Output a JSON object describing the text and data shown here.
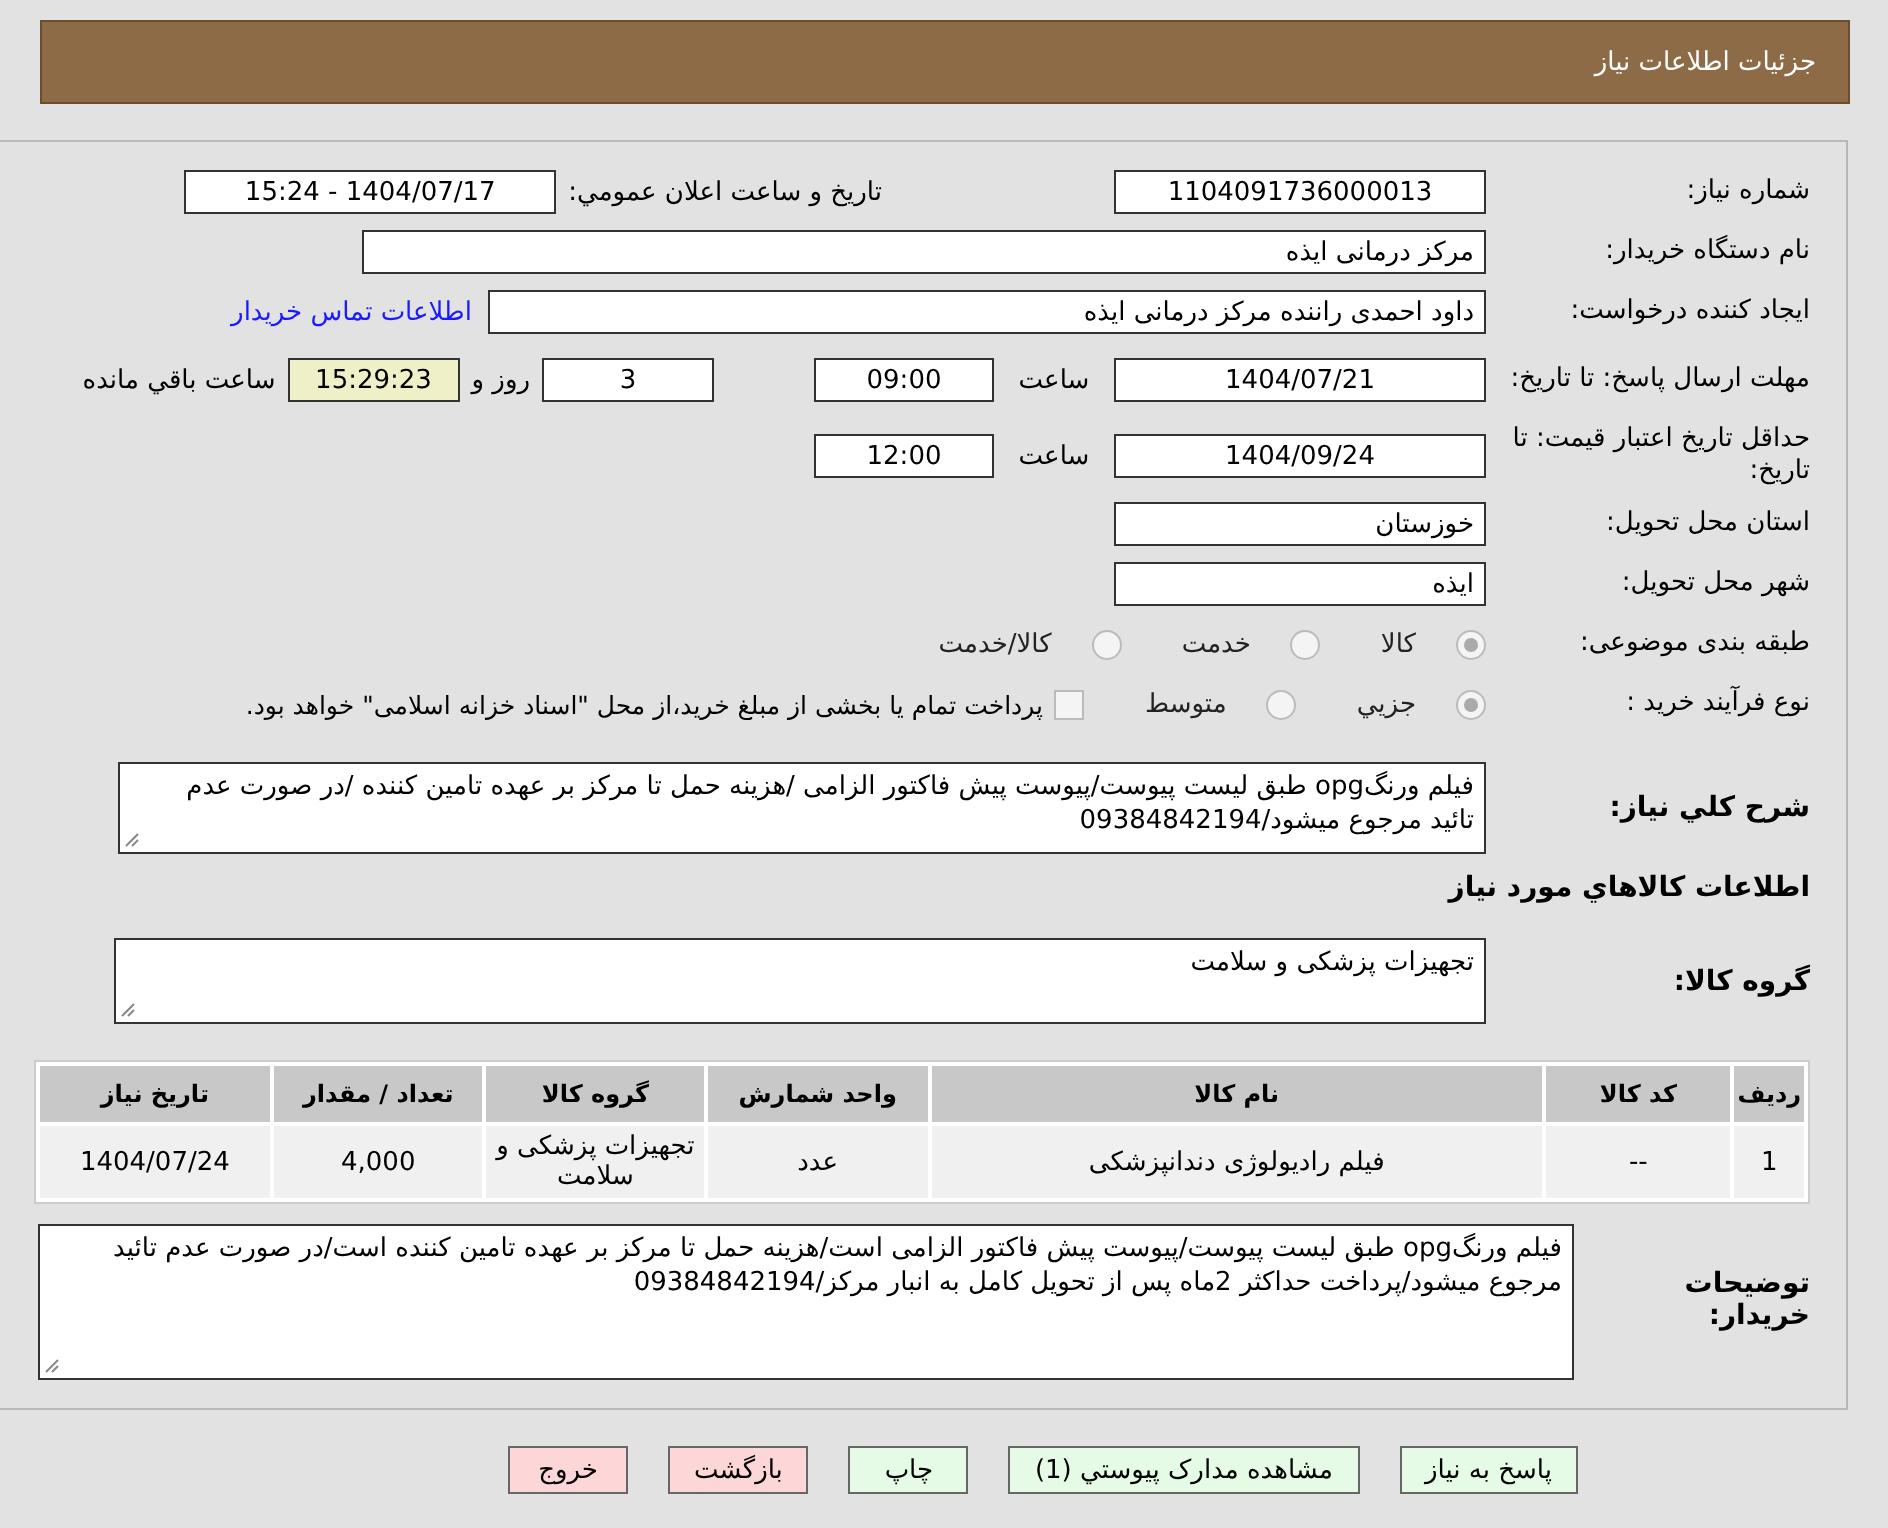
{
  "header": {
    "title": "جزئیات اطلاعات نیاز"
  },
  "need_number": {
    "label": "شماره نیاز:",
    "value": "1104091736000013"
  },
  "announce": {
    "label": "تاریخ و ساعت اعلان عمومي:",
    "value": "1404/07/17 - 15:24"
  },
  "buyer": {
    "label": "نام دستگاه خريدار:",
    "value": "مرکز درمانی ایذه"
  },
  "creator": {
    "label": "ایجاد کننده درخواست:",
    "value": "داود احمدی راننده مرکز درمانی ایذه",
    "link": "اطلاعات تماس خریدار"
  },
  "deadline": {
    "label": "مهلت ارسال پاسخ: تا تاریخ:",
    "date": "1404/07/21",
    "time_label": "ساعت",
    "time": "09:00",
    "days": "3",
    "days_label": "روز و",
    "remaining": "15:29:23",
    "remaining_label": "ساعت باقي مانده"
  },
  "validity": {
    "label": "حداقل تاريخ اعتبار قيمت: تا تاريخ:",
    "date": "1404/09/24",
    "time_label": "ساعت",
    "time": "12:00"
  },
  "province": {
    "label": "استان محل تحویل:",
    "value": "خوزستان"
  },
  "city": {
    "label": "شهر محل تحویل:",
    "value": "ایذه"
  },
  "category": {
    "label": "طبقه بندی موضوعی:",
    "options": [
      {
        "label": "کالا",
        "selected": true
      },
      {
        "label": "خدمت",
        "selected": false
      },
      {
        "label": "کالا/خدمت",
        "selected": false
      }
    ]
  },
  "process": {
    "label": "نوع فرآیند خرید :",
    "options": [
      {
        "label": "جزيي",
        "selected": true
      },
      {
        "label": "متوسط",
        "selected": false
      }
    ],
    "payment": {
      "checked": false,
      "text": "پرداخت تمام یا بخشی از مبلغ خرید،از محل \"اسناد خزانه اسلامی\" خواهد بود."
    }
  },
  "description": {
    "label": "شرح کلي نياز:",
    "value": "فیلم ورنگopg طبق لیست پیوست/پیوست پیش فاکتور الزامی /هزینه حمل تا مرکز بر عهده تامین کننده /در صورت عدم تائید مرجوع میشود/09384842194"
  },
  "goods_title": "اطلاعات کالاهاي مورد نياز",
  "goods_group": {
    "label": "گروه کالا:",
    "value": "تجهیزات پزشکی و سلامت"
  },
  "table": {
    "columns": [
      "رديف",
      "کد کالا",
      "نام کالا",
      "واحد شمارش",
      "گروه کالا",
      "تعداد / مقدار",
      "تاریخ نیاز"
    ],
    "rows": [
      [
        "1",
        "--",
        "فیلم رادیولوژی دندانپزشکی",
        "عدد",
        "تجهیزات پزشکی و سلامت",
        "4,000",
        "1404/07/24"
      ]
    ]
  },
  "notes": {
    "label": "توضیحات خریدار:",
    "value": "فیلم ورنگopg طبق لیست پیوست/پیوست پیش فاکتور الزامی است/هزینه حمل تا مرکز بر عهده تامین کننده است/در صورت عدم تائید مرجوع میشود/پرداخت حداکثر 2ماه پس از تحویل کامل به انبار مرکز/09384842194"
  },
  "buttons": [
    {
      "label": "پاسخ به نیاز",
      "kind": "normal"
    },
    {
      "label": "مشاهده مدارک پیوستي (1)",
      "kind": "normal"
    },
    {
      "label": "چاپ",
      "kind": "normal"
    },
    {
      "label": "بازگشت",
      "kind": "danger"
    },
    {
      "label": "خروج",
      "kind": "danger"
    }
  ]
}
